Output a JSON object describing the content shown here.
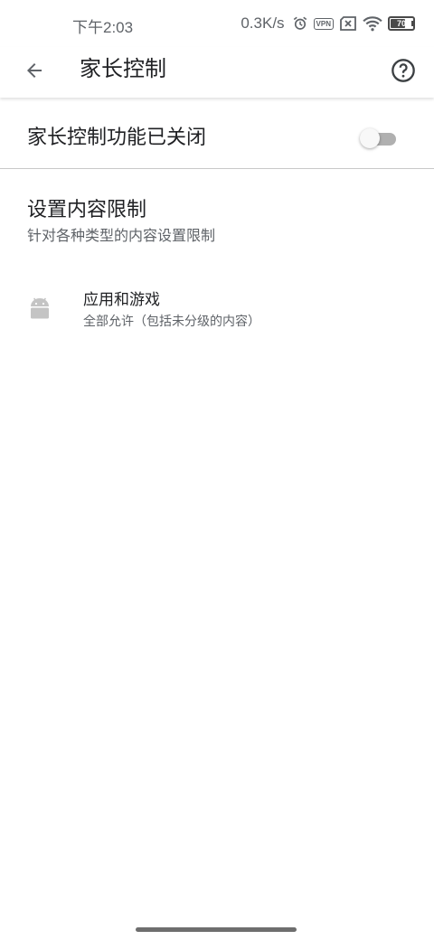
{
  "status_bar": {
    "time": "下午2:03",
    "net_speed": "0.3K/s",
    "vpn_label": "VPN",
    "battery_level": "70"
  },
  "app_bar": {
    "title": "家长控制",
    "back_icon": "arrow-left-icon",
    "help_icon": "help-circle-icon"
  },
  "master_switch": {
    "label": "家长控制功能已关闭",
    "enabled": false
  },
  "content_restrictions": {
    "title": "设置内容限制",
    "subtitle": "针对各种类型的内容设置限制",
    "items": [
      {
        "icon": "android-icon",
        "title": "应用和游戏",
        "summary": "全部允许（包括未分级的内容）"
      }
    ]
  },
  "colors": {
    "text_primary": "#202124",
    "text_secondary": "#5f6368",
    "toggle_track_off": "#b0b0b0",
    "android_icon": "#c4c4c4"
  }
}
